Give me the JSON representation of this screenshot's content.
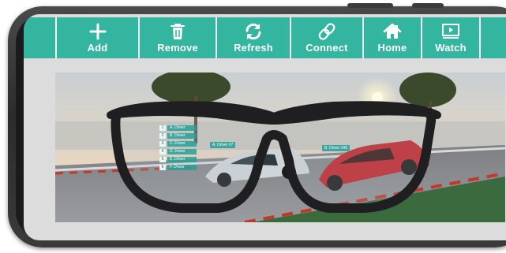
{
  "toolbar": {
    "buttons": [
      {
        "label": "Add",
        "icon": "plus-icon"
      },
      {
        "label": "Remove",
        "icon": "trash-icon"
      },
      {
        "label": "Refresh",
        "icon": "refresh-icon"
      },
      {
        "label": "Connect",
        "icon": "link-icon"
      },
      {
        "label": "Home",
        "icon": "home-icon"
      },
      {
        "label": "Watch",
        "icon": "play-screen-icon"
      }
    ],
    "color": "#33b59f"
  },
  "scene": {
    "drivers": [
      {
        "num": "1",
        "name": "A. Driver"
      },
      {
        "num": "2",
        "name": "B. Driver"
      },
      {
        "num": "3",
        "name": "C. Driver"
      },
      {
        "num": "4",
        "name": "D. Driver"
      },
      {
        "num": "5",
        "name": "E. Driver"
      },
      {
        "num": "6",
        "name": "F. Driver"
      }
    ],
    "left_car_tag": "A. Driver #7",
    "right_car_tag": "B. Driver #36"
  }
}
